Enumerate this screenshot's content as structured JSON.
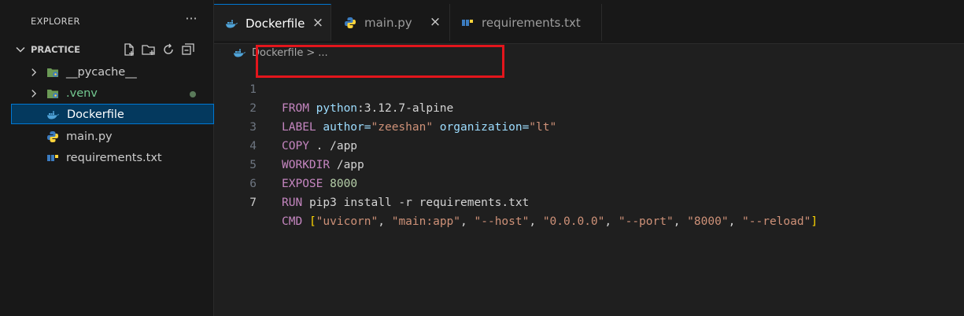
{
  "sidebar": {
    "title": "EXPLORER",
    "more": "···",
    "project": "PRACTICE",
    "items": [
      {
        "label": "__pycache__",
        "expandable": true
      },
      {
        "label": ".venv",
        "expandable": true,
        "color": "#73c991"
      },
      {
        "label": "Dockerfile",
        "selected": true
      },
      {
        "label": "main.py"
      },
      {
        "label": "requirements.txt"
      }
    ]
  },
  "tabs": [
    {
      "label": "Dockerfile",
      "close": "×",
      "active": true
    },
    {
      "label": "main.py",
      "close": "×"
    },
    {
      "label": "requirements.txt"
    }
  ],
  "breadcrumb": {
    "file": "Dockerfile",
    "sep": ">",
    "more": "..."
  },
  "editor": {
    "lines": [
      {
        "n": "1",
        "kw": "FROM",
        "rest": [
          "python",
          ":3.12.7-alpine"
        ]
      },
      {
        "n": "2",
        "kw": "LABEL",
        "rest": [
          "author=",
          "\"zeeshan\"",
          " organization=",
          "\"lt\""
        ]
      },
      {
        "n": "3",
        "kw": "COPY",
        "rest": [
          ". /app"
        ]
      },
      {
        "n": "4",
        "kw": "WORKDIR",
        "rest": [
          "/app"
        ]
      },
      {
        "n": "5",
        "kw": "EXPOSE",
        "rest": [
          "8000"
        ]
      },
      {
        "n": "6",
        "kw": "RUN",
        "rest": [
          "pip3 install -r requirements.txt"
        ]
      },
      {
        "n": "7",
        "kw": "CMD",
        "rest": [
          "[",
          "\"uvicorn\"",
          ", ",
          "\"main:app\"",
          ", ",
          "\"--host\"",
          ", ",
          "\"0.0.0.0\"",
          ", ",
          "\"--port\"",
          ", ",
          "\"8000\"",
          ", ",
          "\"--reload\"",
          "]"
        ]
      }
    ]
  },
  "colors": {
    "accent": "#0078d4",
    "highlight": "#e3151c"
  }
}
